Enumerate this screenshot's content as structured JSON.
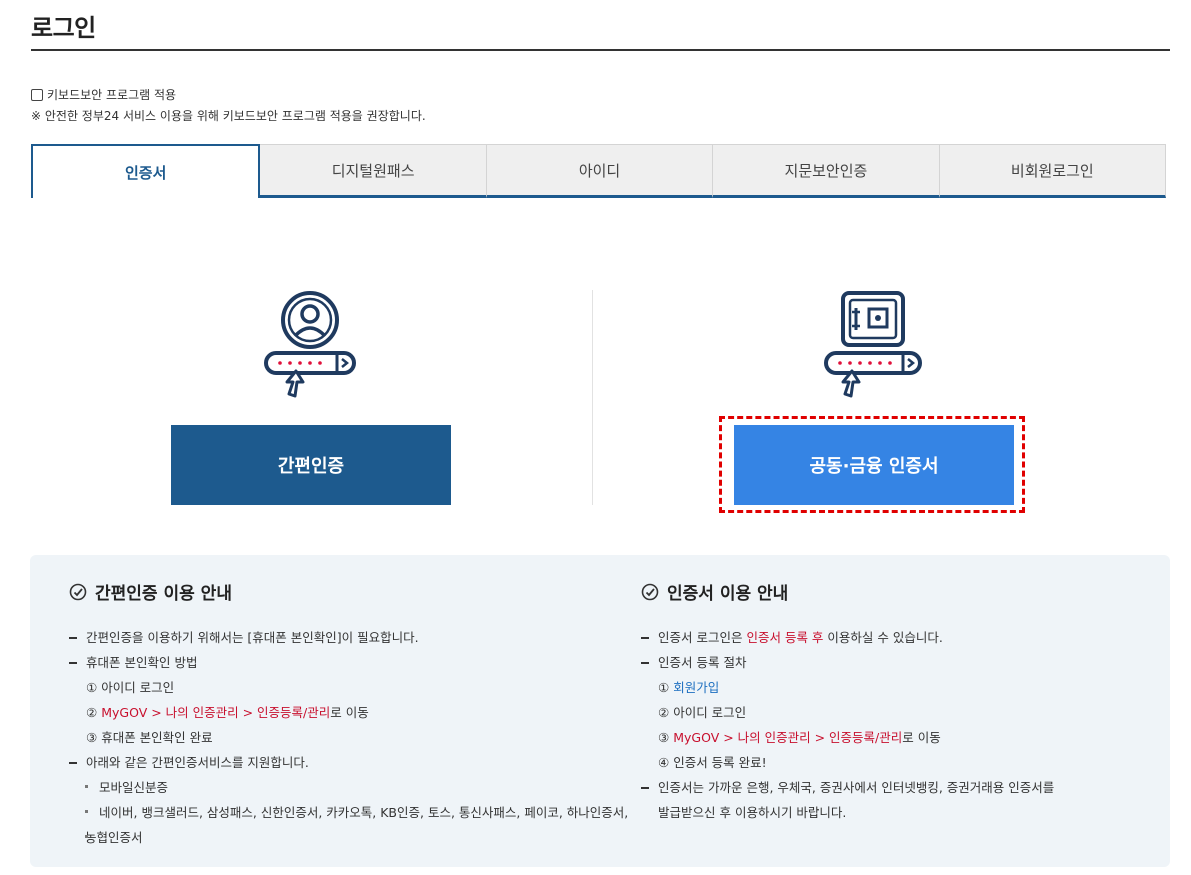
{
  "page": {
    "title": "로그인"
  },
  "keyboard_security": {
    "label": "키보드보안 프로그램 적용",
    "checked": false,
    "notice": "※ 안전한 정부24 서비스 이용을 위해 키보드보안 프로그램 적용을 권장합니다."
  },
  "tabs": [
    {
      "label": "인증서",
      "active": true
    },
    {
      "label": "디지털원패스",
      "active": false
    },
    {
      "label": "아이디",
      "active": false
    },
    {
      "label": "지문보안인증",
      "active": false
    },
    {
      "label": "비회원로그인",
      "active": false
    }
  ],
  "login_options": {
    "simple": {
      "button_label": "간편인증",
      "icon": "person-card-icon"
    },
    "certificate": {
      "button_label": "공동·금융 인증서",
      "icon": "safe-card-icon"
    }
  },
  "guide": {
    "simple": {
      "title": "간편인증 이용 안내",
      "items": [
        "간편인증을 이용하기 위해서는 [휴대폰 본인확인]이 필요합니다.",
        "휴대폰 본인확인 방법"
      ],
      "steps": [
        {
          "num": "①",
          "text": "아이디 로그인"
        },
        {
          "num": "②",
          "link": "MyGOV > 나의 인증관리 > 인증등록/관리",
          "suffix": "로 이동"
        },
        {
          "num": "③",
          "text": "휴대폰 본인확인 완료"
        }
      ],
      "support_intro": "아래와 같은 간편인증서비스를 지원합니다.",
      "services": [
        "모바일신분증",
        "네이버, 뱅크샐러드, 삼성패스, 신한인증서, 카카오톡, KB인증, 토스, 통신사패스, 페이코, 하나인증서,"
      ],
      "services_cont": "농협인증서"
    },
    "certificate": {
      "title": "인증서 이용 안내",
      "item1_prefix": "인증서 로그인은",
      "item1_highlight": "인증서 등록 후",
      "item1_suffix": "이용하실 수 있습니다.",
      "item2": "인증서 등록 절차",
      "steps": [
        {
          "num": "①",
          "link": "회원가입"
        },
        {
          "num": "②",
          "text": "아이디 로그인"
        },
        {
          "num": "③",
          "link": "MyGOV > 나의 인증관리 > 인증등록/관리",
          "suffix": "로 이동"
        },
        {
          "num": "④",
          "text": "인증서 등록 완료!"
        }
      ],
      "item3_line1": "인증서는 가까운 은행, 우체국, 증권사에서 인터넷뱅킹, 증권거래용 인증서를",
      "item3_line2": "발급받으신 후 이용하시기 바랍니다."
    }
  },
  "colors": {
    "primary": "#1d5a8e",
    "cert_button": "#3584e4",
    "highlight_border": "#e00000",
    "red_text": "#c8102e",
    "link_blue": "#1d6fc0",
    "guide_bg": "#eff4f8"
  }
}
